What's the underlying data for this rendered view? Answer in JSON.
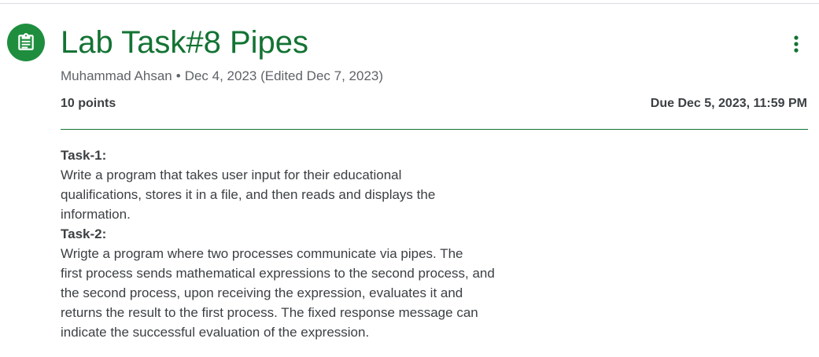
{
  "assignment": {
    "icon": "assignment-icon",
    "title": "Lab Task#8 Pipes",
    "author": "Muhammad Ahsan",
    "separator": "•",
    "posted": "Dec 4, 2023 (Edited Dec 7, 2023)",
    "points": "10 points",
    "due": "Due Dec 5, 2023, 11:59 PM",
    "more_icon": "more-vert-icon"
  },
  "colors": {
    "accent": "#1e8e3e",
    "title": "#137333",
    "meta": "#5f6368",
    "text": "#3c4043",
    "rule": "#dadce0"
  },
  "description": {
    "task1": {
      "heading": "Task-1:",
      "lines": [
        "Write a program that takes user input for their educational",
        "qualifications, stores it in a file, and then reads and displays the",
        "information."
      ]
    },
    "task2": {
      "heading": "Task-2:",
      "lines": [
        "Wrigte a program where two processes communicate via pipes. The",
        "first process sends mathematical expressions to the second process, and",
        "the second process, upon receiving the expression, evaluates it and",
        "returns the result to the first process. The fixed response message can",
        "indicate the successful evaluation of the expression."
      ]
    }
  }
}
